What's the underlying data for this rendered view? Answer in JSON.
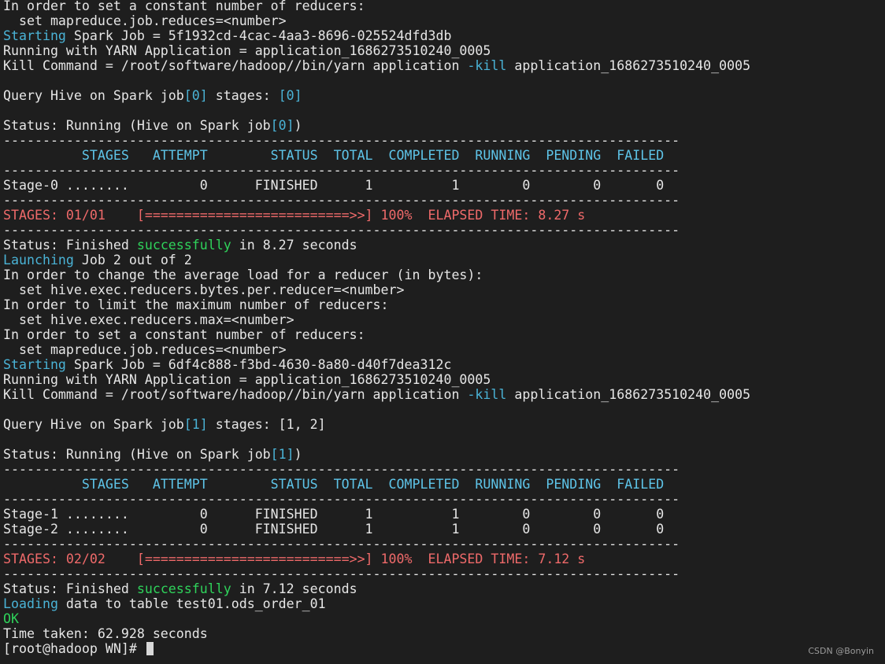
{
  "colors": {
    "background": "#1e1e1e",
    "text": "#e6e6e6",
    "blue": "#4ab3d6",
    "cyan": "#5ec4e8",
    "green": "#2fd35b",
    "red": "#ef6a6a"
  },
  "lines": [
    [
      [
        "white",
        "In order to set a constant number of reducers:"
      ]
    ],
    [
      [
        "white",
        "  set mapreduce.job.reduces=<number>"
      ]
    ],
    [
      [
        "blue",
        "Starting"
      ],
      [
        "white",
        " Spark Job = 5f1932cd-4cac-4aa3-8696-025524dfd3db"
      ]
    ],
    [
      [
        "white",
        "Running with YARN Application = application_1686273510240_0005"
      ]
    ],
    [
      [
        "white",
        "Kill Command = /root/software/hadoop//bin/yarn application "
      ],
      [
        "blue",
        "-kill"
      ],
      [
        "white",
        " application_1686273510240_0005"
      ]
    ],
    [
      [
        "white",
        ""
      ]
    ],
    [
      [
        "white",
        "Query Hive on Spark job"
      ],
      [
        "blue",
        "[0]"
      ],
      [
        "white",
        " stages: "
      ],
      [
        "blue",
        "[0]"
      ]
    ],
    [
      [
        "white",
        ""
      ]
    ],
    [
      [
        "white",
        "Status: Running (Hive on Spark job"
      ],
      [
        "blue",
        "[0]"
      ],
      [
        "white",
        ")"
      ]
    ],
    [
      [
        "white",
        "--------------------------------------------------------------------------------------"
      ]
    ],
    [
      [
        "cyan",
        "          STAGES   ATTEMPT        STATUS  TOTAL  COMPLETED  RUNNING  PENDING  FAILED"
      ]
    ],
    [
      [
        "white",
        "--------------------------------------------------------------------------------------"
      ]
    ],
    [
      [
        "white",
        "Stage-0 ........         0      FINISHED      1          1        0        0       0"
      ]
    ],
    [
      [
        "white",
        "--------------------------------------------------------------------------------------"
      ]
    ],
    [
      [
        "red",
        "STAGES: 01/01    [==========================>>] 100%  ELAPSED TIME: 8.27 s"
      ]
    ],
    [
      [
        "white",
        "--------------------------------------------------------------------------------------"
      ]
    ],
    [
      [
        "white",
        "Status: Finished "
      ],
      [
        "green",
        "successfully"
      ],
      [
        "white",
        " in 8.27 seconds"
      ]
    ],
    [
      [
        "blue",
        "Launching"
      ],
      [
        "white",
        " Job 2 out of 2"
      ]
    ],
    [
      [
        "white",
        "In order to change the average load for a reducer (in bytes):"
      ]
    ],
    [
      [
        "white",
        "  set hive.exec.reducers.bytes.per.reducer=<number>"
      ]
    ],
    [
      [
        "white",
        "In order to limit the maximum number of reducers:"
      ]
    ],
    [
      [
        "white",
        "  set hive.exec.reducers.max=<number>"
      ]
    ],
    [
      [
        "white",
        "In order to set a constant number of reducers:"
      ]
    ],
    [
      [
        "white",
        "  set mapreduce.job.reduces=<number>"
      ]
    ],
    [
      [
        "blue",
        "Starting"
      ],
      [
        "white",
        " Spark Job = 6df4c888-f3bd-4630-8a80-d40f7dea312c"
      ]
    ],
    [
      [
        "white",
        "Running with YARN Application = application_1686273510240_0005"
      ]
    ],
    [
      [
        "white",
        "Kill Command = /root/software/hadoop//bin/yarn application "
      ],
      [
        "blue",
        "-kill"
      ],
      [
        "white",
        " application_1686273510240_0005"
      ]
    ],
    [
      [
        "white",
        ""
      ]
    ],
    [
      [
        "white",
        "Query Hive on Spark job"
      ],
      [
        "blue",
        "[1]"
      ],
      [
        "white",
        " stages: [1, 2]"
      ]
    ],
    [
      [
        "white",
        ""
      ]
    ],
    [
      [
        "white",
        "Status: Running (Hive on Spark job"
      ],
      [
        "blue",
        "[1]"
      ],
      [
        "white",
        ")"
      ]
    ],
    [
      [
        "white",
        "--------------------------------------------------------------------------------------"
      ]
    ],
    [
      [
        "cyan",
        "          STAGES   ATTEMPT        STATUS  TOTAL  COMPLETED  RUNNING  PENDING  FAILED"
      ]
    ],
    [
      [
        "white",
        "--------------------------------------------------------------------------------------"
      ]
    ],
    [
      [
        "white",
        "Stage-1 ........         0      FINISHED      1          1        0        0       0"
      ]
    ],
    [
      [
        "white",
        "Stage-2 ........         0      FINISHED      1          1        0        0       0"
      ]
    ],
    [
      [
        "white",
        "--------------------------------------------------------------------------------------"
      ]
    ],
    [
      [
        "red",
        "STAGES: 02/02    [==========================>>] 100%  ELAPSED TIME: 7.12 s"
      ]
    ],
    [
      [
        "white",
        "--------------------------------------------------------------------------------------"
      ]
    ],
    [
      [
        "white",
        "Status: Finished "
      ],
      [
        "green",
        "successfully"
      ],
      [
        "white",
        " in 7.12 seconds"
      ]
    ],
    [
      [
        "blue",
        "Loading"
      ],
      [
        "white",
        " data to table test01.ods_order_01"
      ]
    ],
    [
      [
        "green",
        "OK"
      ]
    ],
    [
      [
        "white",
        "Time taken: 62.928 seconds"
      ]
    ],
    [
      [
        "white",
        "[root@hadoop WN]# "
      ]
    ]
  ],
  "watermark": "CSDN @Bonyin"
}
